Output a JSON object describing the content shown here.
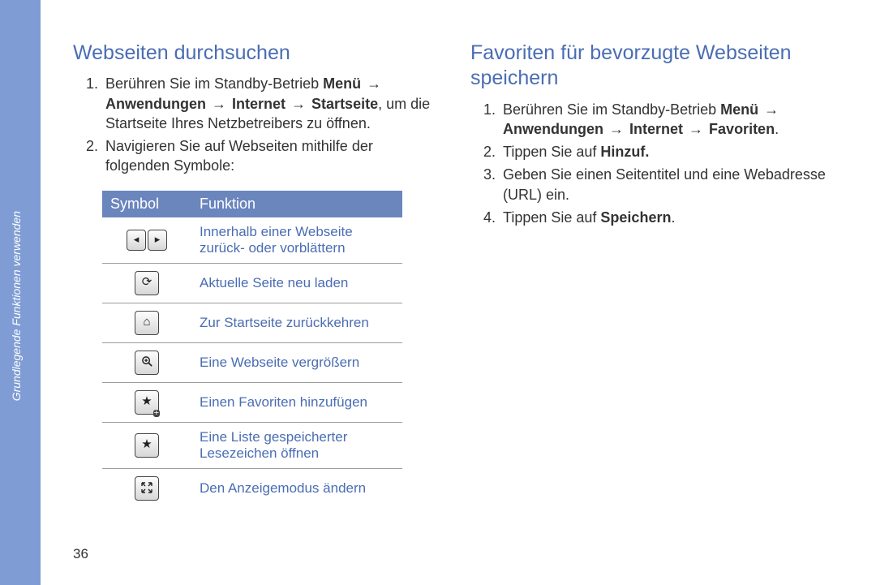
{
  "sidebar": {
    "section_label": "Grundlegende Funktionen verwenden"
  },
  "page_number": "36",
  "left": {
    "heading": "Webseiten durchsuchen",
    "steps": [
      {
        "pre": "Berühren Sie im Standby-Betrieb ",
        "b1": "Menü",
        "arrow1": " → ",
        "b2": "Anwendungen",
        "arrow2": " → ",
        "b3": "Internet",
        "arrow3": " → ",
        "b4": "Startseite",
        "post": ", um die Startseite Ihres Netzbetreibers zu öffnen."
      },
      {
        "text": "Navigieren Sie auf Webseiten mithilfe der folgenden Symbole:"
      }
    ],
    "table": {
      "headers": {
        "symbol": "Symbol",
        "function": "Funktion"
      },
      "rows": [
        {
          "icon_name": "nav-left-right-icon",
          "function": "Innerhalb einer Webseite zurück- oder vorblättern"
        },
        {
          "icon_name": "reload-icon",
          "function": "Aktuelle Seite neu laden"
        },
        {
          "icon_name": "home-icon",
          "function": "Zur Startseite zurückkehren"
        },
        {
          "icon_name": "zoom-icon",
          "function": "Eine Webseite vergrößern"
        },
        {
          "icon_name": "add-favorite-icon",
          "function": "Einen Favoriten hinzufügen"
        },
        {
          "icon_name": "bookmarks-icon",
          "function": "Eine Liste gespeicherter Lesezeichen öffnen"
        },
        {
          "icon_name": "view-mode-icon",
          "function": "Den Anzeigemodus ändern"
        }
      ]
    }
  },
  "right": {
    "heading": "Favoriten für bevorzugte Webseiten speichern",
    "steps": [
      {
        "pre": "Berühren Sie im Standby-Betrieb ",
        "b1": "Menü",
        "arrow1": " → ",
        "b2": "Anwendungen",
        "arrow2": " → ",
        "b3": "Internet",
        "arrow3": " → ",
        "b4": "Favoriten",
        "post": "."
      },
      {
        "pre": "Tippen Sie auf ",
        "b1": "Hinzuf.",
        "post": ""
      },
      {
        "text": "Geben Sie einen Seitentitel und eine Webadresse (URL) ein."
      },
      {
        "pre": "Tippen Sie auf ",
        "b1": "Speichern",
        "post": "."
      }
    ]
  }
}
